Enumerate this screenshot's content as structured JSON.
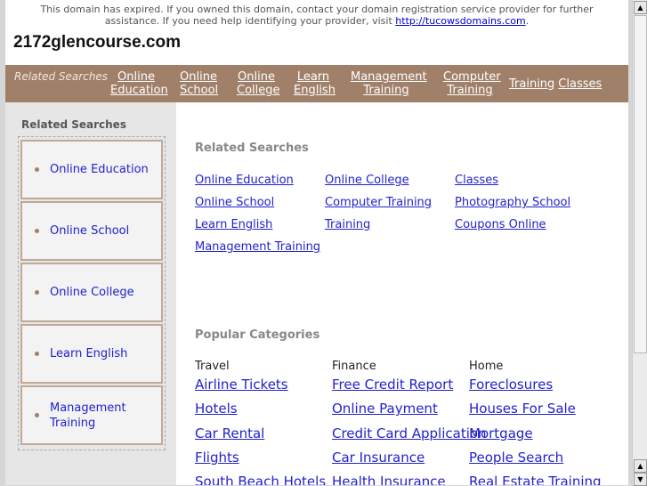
{
  "notice": {
    "text": "This domain has expired. If you owned this domain, contact your domain registration service provider for further assistance. If you need help identifying your provider, visit ",
    "link": "http://tucowsdomains.com",
    "suffix": "."
  },
  "domain": "2172glencourse.com",
  "nav": {
    "label": "Related Searches",
    "links": [
      "Online Education",
      "Online School",
      "Online College",
      "Learn English",
      "Management Training",
      "Computer Training",
      "Training",
      "Classes"
    ]
  },
  "sidebar": {
    "title": "Related Searches",
    "items": [
      "Online Education",
      "Online School",
      "Online College",
      "Learn English",
      "Management Training"
    ]
  },
  "related": {
    "title": "Related Searches",
    "links": [
      "Online Education",
      "Online College",
      "Classes",
      "Online School",
      "Computer Training",
      "Photography School",
      "Learn English",
      "Training",
      "Coupons Online",
      "Management Training"
    ]
  },
  "popular": {
    "title": "Popular Categories",
    "categories": [
      {
        "name": "Travel",
        "links": [
          "Airline Tickets",
          "Hotels",
          "Car Rental",
          "Flights",
          "South Beach Hotels"
        ]
      },
      {
        "name": "Finance",
        "links": [
          "Free Credit Report",
          "Online Payment",
          "Credit Card Application",
          "Car Insurance",
          "Health Insurance"
        ]
      },
      {
        "name": "Home",
        "links": [
          "Foreclosures",
          "Houses For Sale",
          "Mortgage",
          "People Search",
          "Real Estate Training"
        ]
      }
    ]
  },
  "colors": {
    "nav": "#a08069",
    "link": "#2222cc",
    "sidebar": "#e6e6e6"
  }
}
